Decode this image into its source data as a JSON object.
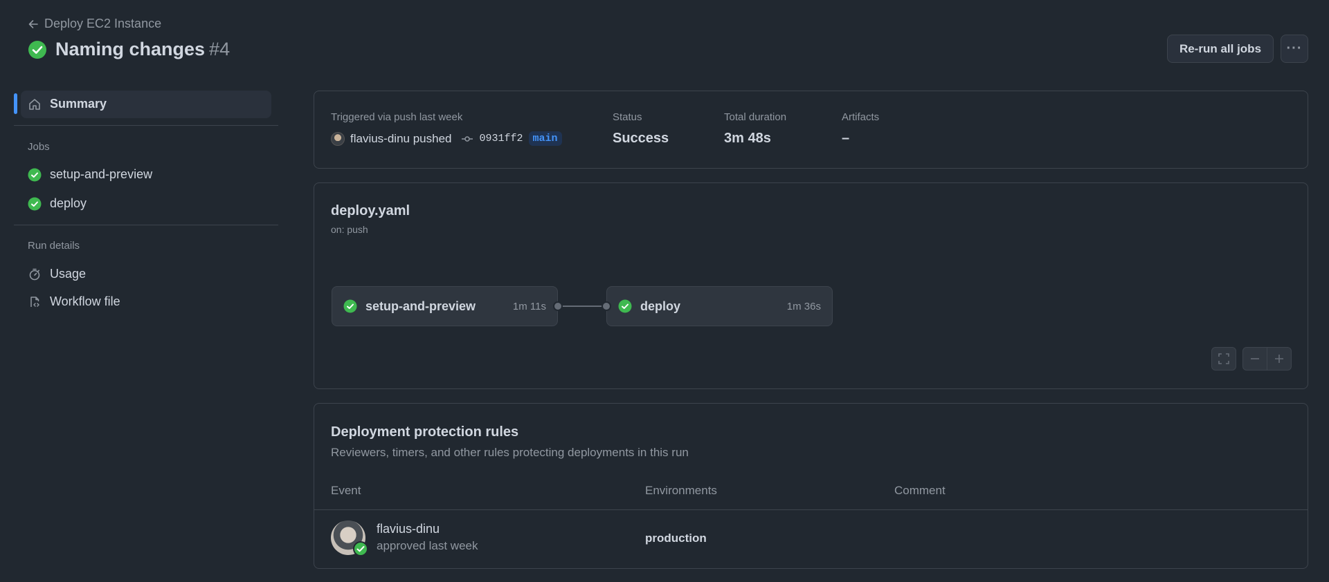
{
  "header": {
    "back_label": "Deploy EC2 Instance",
    "title": "Naming changes",
    "run_number": "#4",
    "rerun_label": "Re-run all jobs",
    "more_label": "···"
  },
  "sidebar": {
    "summary_label": "Summary",
    "jobs_heading": "Jobs",
    "jobs": [
      {
        "label": "setup-and-preview",
        "status": "success"
      },
      {
        "label": "deploy",
        "status": "success"
      }
    ],
    "run_details_heading": "Run details",
    "details": [
      {
        "label": "Usage",
        "icon": "stopwatch-icon"
      },
      {
        "label": "Workflow file",
        "icon": "file-code-icon"
      }
    ]
  },
  "summary": {
    "trigger_label": "Triggered via push last week",
    "actor": "flavius-dinu pushed",
    "commit_sha": "0931ff2",
    "branch": "main",
    "status_label": "Status",
    "status_value": "Success",
    "duration_label": "Total duration",
    "duration_value": "3m 48s",
    "artifacts_label": "Artifacts",
    "artifacts_value": "–"
  },
  "workflow": {
    "file_name": "deploy.yaml",
    "event": "on: push",
    "jobs": [
      {
        "name": "setup-and-preview",
        "duration": "1m 11s"
      },
      {
        "name": "deploy",
        "duration": "1m 36s"
      }
    ]
  },
  "protection": {
    "title": "Deployment protection rules",
    "subtitle": "Reviewers, timers, and other rules protecting deployments in this run",
    "columns": {
      "event": "Event",
      "environments": "Environments",
      "comment": "Comment"
    },
    "rows": [
      {
        "reviewer": "flavius-dinu",
        "status": "approved last week",
        "environment": "production",
        "comment": ""
      }
    ]
  },
  "colors": {
    "success": "#3fb950",
    "accent": "#4493f8",
    "background": "#212830"
  }
}
